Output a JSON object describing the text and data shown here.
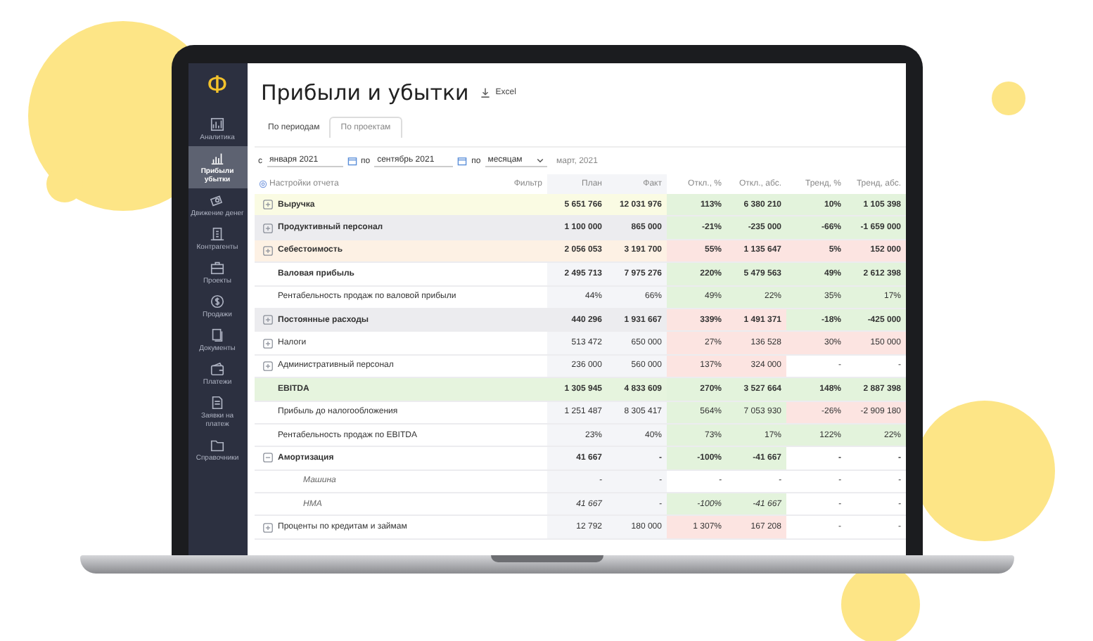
{
  "logo": "Ф",
  "sidebar": {
    "items": [
      {
        "label": "Аналитика",
        "selected": false
      },
      {
        "label": "Прибыли убытки",
        "selected": true
      },
      {
        "label": "Движение денег",
        "selected": false
      },
      {
        "label": "Контрагенты",
        "selected": false
      },
      {
        "label": "Проекты",
        "selected": false
      },
      {
        "label": "Продажи",
        "selected": false
      },
      {
        "label": "Документы",
        "selected": false
      },
      {
        "label": "Платежи",
        "selected": false
      },
      {
        "label": "Заявки на платеж",
        "selected": false
      },
      {
        "label": "Справочники",
        "selected": false
      }
    ]
  },
  "title": "Прибыли и убытки",
  "export_link": "Excel",
  "tabs": [
    {
      "label": "По периодам",
      "selected": true
    },
    {
      "label": "По проектам",
      "selected": false
    }
  ],
  "filters": {
    "from_label": "с",
    "from": "января 2021",
    "to_label": "по",
    "to": "сентябрь 2021",
    "by_label": "по",
    "by": "месяцам",
    "period": "март, 2021"
  },
  "table": {
    "settings": "Настройки отчета",
    "filter": "Фильтр",
    "columns": [
      "План",
      "Факт",
      "Откл., %",
      "Откл., абс.",
      "Тренд, %",
      "Тренд, абс."
    ],
    "rows": [
      {
        "name": "Выручка",
        "kind": "group",
        "expanded": false,
        "color": "#fafbe3",
        "cells": [
          {
            "text": "5 651 766"
          },
          {
            "text": "12 031 976"
          },
          {
            "text": "113%",
            "color": "#e3f3dc"
          },
          {
            "text": "6 380 210",
            "color": "#e3f3dc"
          },
          {
            "text": "10%",
            "color": "#e3f3dc"
          },
          {
            "text": "1 105 398",
            "color": "#e3f3dc"
          }
        ]
      },
      {
        "name": "Продуктивный персонал",
        "kind": "group",
        "expanded": false,
        "color": "#ececef",
        "cells": [
          {
            "text": "1 100 000"
          },
          {
            "text": "865 000"
          },
          {
            "text": "-21%",
            "color": "#e3f3dc"
          },
          {
            "text": "-235 000",
            "color": "#e3f3dc"
          },
          {
            "text": "-66%",
            "color": "#e3f3dc"
          },
          {
            "text": "-1 659 000",
            "color": "#e3f3dc"
          }
        ]
      },
      {
        "name": "Себестоимость",
        "kind": "group",
        "expanded": false,
        "color": "#fdf1e4",
        "cells": [
          {
            "text": "2 056 053"
          },
          {
            "text": "3 191 700"
          },
          {
            "text": "55%",
            "color": "#fce4e1"
          },
          {
            "text": "1 135 647",
            "color": "#fce4e1"
          },
          {
            "text": "5%",
            "color": "#fce4e1"
          },
          {
            "text": "152 000",
            "color": "#fce4e1"
          }
        ]
      },
      {
        "name": "Валовая прибыль",
        "kind": "total",
        "cells": [
          {
            "text": "2 495 713"
          },
          {
            "text": "7 975 276"
          },
          {
            "text": "220%",
            "color": "#e3f3dc"
          },
          {
            "text": "5 479 563",
            "color": "#e3f3dc"
          },
          {
            "text": "49%",
            "color": "#e3f3dc"
          },
          {
            "text": "2 612 398",
            "color": "#e3f3dc"
          }
        ]
      },
      {
        "name": "Рентабельность продаж по валовой прибыли",
        "kind": "ratio",
        "cells": [
          {
            "text": "44%"
          },
          {
            "text": "66%"
          },
          {
            "text": "49%",
            "color": "#e3f3dc"
          },
          {
            "text": "22%",
            "color": "#e3f3dc"
          },
          {
            "text": "35%",
            "color": "#e3f3dc"
          },
          {
            "text": "17%",
            "color": "#e3f3dc"
          }
        ]
      },
      {
        "name": "Постоянные расходы",
        "kind": "group",
        "expanded": false,
        "color": "#ececef",
        "cells": [
          {
            "text": "440 296"
          },
          {
            "text": "1 931 667"
          },
          {
            "text": "339%",
            "color": "#fce4e1"
          },
          {
            "text": "1 491 371",
            "color": "#fce4e1"
          },
          {
            "text": "-18%",
            "color": "#e3f3dc"
          },
          {
            "text": "-425 000",
            "color": "#e3f3dc"
          }
        ]
      },
      {
        "name": "Налоги",
        "kind": "item",
        "expanded": false,
        "cells": [
          {
            "text": "513 472"
          },
          {
            "text": "650 000"
          },
          {
            "text": "27%",
            "color": "#fce4e1"
          },
          {
            "text": "136 528",
            "color": "#fce4e1"
          },
          {
            "text": "30%",
            "color": "#fce4e1"
          },
          {
            "text": "150 000",
            "color": "#fce4e1"
          }
        ]
      },
      {
        "name": "Административный персонал",
        "kind": "item",
        "expanded": false,
        "cells": [
          {
            "text": "236 000"
          },
          {
            "text": "560 000"
          },
          {
            "text": "137%",
            "color": "#fce4e1"
          },
          {
            "text": "324 000",
            "color": "#fce4e1"
          },
          {
            "text": "-"
          },
          {
            "text": "-"
          }
        ]
      },
      {
        "name": "EBITDA",
        "kind": "total",
        "color": "#e6f4de",
        "cells": [
          {
            "text": "1 305 945"
          },
          {
            "text": "4 833 609"
          },
          {
            "text": "270%",
            "color": "#e3f3dc"
          },
          {
            "text": "3 527 664",
            "color": "#e3f3dc"
          },
          {
            "text": "148%",
            "color": "#e3f3dc"
          },
          {
            "text": "2 887 398",
            "color": "#e3f3dc"
          }
        ]
      },
      {
        "name": "Прибыль до налогообложения",
        "kind": "ratio",
        "cells": [
          {
            "text": "1 251 487"
          },
          {
            "text": "8 305 417"
          },
          {
            "text": "564%",
            "color": "#e3f3dc"
          },
          {
            "text": "7 053 930",
            "color": "#e3f3dc"
          },
          {
            "text": "-26%",
            "color": "#fce4e1"
          },
          {
            "text": "-2 909 180",
            "color": "#fce4e1"
          }
        ]
      },
      {
        "name": "Рентабельность продаж по EBITDA",
        "kind": "ratio",
        "cells": [
          {
            "text": "23%"
          },
          {
            "text": "40%"
          },
          {
            "text": "73%",
            "color": "#e3f3dc"
          },
          {
            "text": "17%",
            "color": "#e3f3dc"
          },
          {
            "text": "122%",
            "color": "#e3f3dc"
          },
          {
            "text": "22%",
            "color": "#e3f3dc"
          }
        ]
      },
      {
        "name": "Амортизация",
        "kind": "group",
        "expanded": true,
        "cells": [
          {
            "text": "41 667"
          },
          {
            "text": "-"
          },
          {
            "text": "-100%",
            "color": "#e3f3dc"
          },
          {
            "text": "-41 667",
            "color": "#e3f3dc"
          },
          {
            "text": "-"
          },
          {
            "text": "-"
          }
        ]
      },
      {
        "name": "Машина",
        "kind": "child",
        "cells": [
          {
            "text": "-"
          },
          {
            "text": "-"
          },
          {
            "text": "-"
          },
          {
            "text": "-"
          },
          {
            "text": "-"
          },
          {
            "text": "-"
          }
        ]
      },
      {
        "name": "НМА",
        "kind": "child",
        "cells": [
          {
            "text": "41 667"
          },
          {
            "text": "-"
          },
          {
            "text": "-100%",
            "color": "#e3f3dc"
          },
          {
            "text": "-41 667",
            "color": "#e3f3dc"
          },
          {
            "text": "-"
          },
          {
            "text": "-"
          }
        ]
      },
      {
        "name": "Проценты по кредитам и займам",
        "kind": "item",
        "expanded": false,
        "cells": [
          {
            "text": "12 792"
          },
          {
            "text": "180 000"
          },
          {
            "text": "1 307%",
            "color": "#fce4e1"
          },
          {
            "text": "167 208",
            "color": "#fce4e1"
          },
          {
            "text": "-"
          },
          {
            "text": "-"
          }
        ]
      }
    ]
  }
}
